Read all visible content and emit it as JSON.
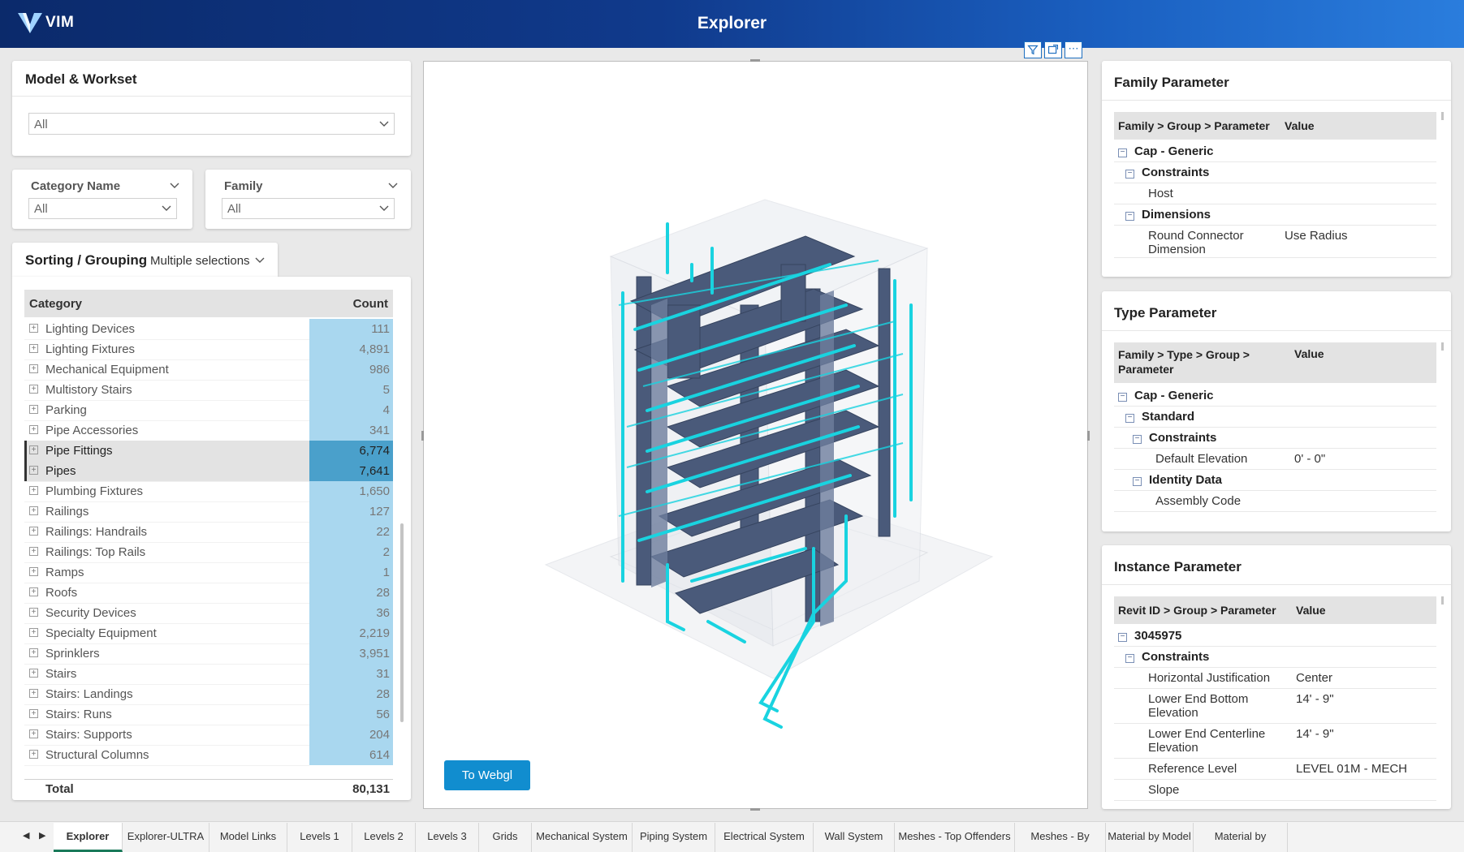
{
  "app": {
    "logo_text": "VIM",
    "title": "Explorer"
  },
  "model_workset": {
    "title": "Model & Workset",
    "value": "All"
  },
  "category_filter": {
    "title": "Category Name",
    "value": "All"
  },
  "family_filter": {
    "title": "Family",
    "value": "All"
  },
  "sorting": {
    "title": "Sorting / Grouping",
    "value": "Multiple selections"
  },
  "category_table": {
    "col_category": "Category",
    "col_count": "Count",
    "rows": [
      {
        "name": "Lighting Devices",
        "count": "111"
      },
      {
        "name": "Lighting Fixtures",
        "count": "4,891"
      },
      {
        "name": "Mechanical Equipment",
        "count": "986"
      },
      {
        "name": "Multistory Stairs",
        "count": "5"
      },
      {
        "name": "Parking",
        "count": "4"
      },
      {
        "name": "Pipe Accessories",
        "count": "341"
      },
      {
        "name": "Pipe Fittings",
        "count": "6,774"
      },
      {
        "name": "Pipes",
        "count": "7,641"
      },
      {
        "name": "Plumbing Fixtures",
        "count": "1,650"
      },
      {
        "name": "Railings",
        "count": "127"
      },
      {
        "name": "Railings: Handrails",
        "count": "22"
      },
      {
        "name": "Railings: Top Rails",
        "count": "2"
      },
      {
        "name": "Ramps",
        "count": "1"
      },
      {
        "name": "Roofs",
        "count": "28"
      },
      {
        "name": "Security Devices",
        "count": "36"
      },
      {
        "name": "Specialty Equipment",
        "count": "2,219"
      },
      {
        "name": "Sprinklers",
        "count": "3,951"
      },
      {
        "name": "Stairs",
        "count": "31"
      },
      {
        "name": "Stairs: Landings",
        "count": "28"
      },
      {
        "name": "Stairs: Runs",
        "count": "56"
      },
      {
        "name": "Stairs: Supports",
        "count": "204"
      },
      {
        "name": "Structural Columns",
        "count": "614"
      }
    ],
    "total_label": "Total",
    "total_value": "80,131"
  },
  "viewer": {
    "button_label": "To Webgl"
  },
  "family_param": {
    "title": "Family Parameter",
    "col_key": "Family > Group > Parameter",
    "col_value": "Value",
    "rows": [
      {
        "k": "Cap - Generic",
        "v": ""
      },
      {
        "k": "Constraints",
        "v": ""
      },
      {
        "k": "Host",
        "v": ""
      },
      {
        "k": "Dimensions",
        "v": ""
      },
      {
        "k": "Round Connector Dimension",
        "v": "Use Radius"
      }
    ]
  },
  "type_param": {
    "title": "Type Parameter",
    "col_key": "Family > Type > Group > Parameter",
    "col_value": "Value",
    "rows": [
      {
        "k": "Cap - Generic",
        "v": ""
      },
      {
        "k": "Standard",
        "v": ""
      },
      {
        "k": "Constraints",
        "v": ""
      },
      {
        "k": "Default Elevation",
        "v": "0' - 0\""
      },
      {
        "k": "Identity Data",
        "v": ""
      },
      {
        "k": "Assembly Code",
        "v": ""
      }
    ]
  },
  "instance_param": {
    "title": "Instance Parameter",
    "col_key": "Revit ID > Group > Parameter",
    "col_value": "Value",
    "rows": [
      {
        "k": "3045975",
        "v": ""
      },
      {
        "k": "Constraints",
        "v": ""
      },
      {
        "k": "Horizontal Justification",
        "v": "Center"
      },
      {
        "k": "Lower End Bottom Elevation",
        "v": "14' - 9\""
      },
      {
        "k": "Lower End Centerline Elevation",
        "v": "14' - 9\""
      },
      {
        "k": "Reference Level",
        "v": "LEVEL 01M - MECH"
      },
      {
        "k": "Slope",
        "v": ""
      }
    ]
  },
  "tabs": [
    "Explorer",
    "Explorer-ULTRA",
    "Model Links",
    "Levels 1",
    "Levels 2",
    "Levels 3",
    "Grids",
    "Mechanical System",
    "Piping System",
    "Electrical System",
    "Wall System",
    "Meshes - Top Offenders",
    "Meshes - By Model",
    "Material by Model",
    "Material by Category"
  ],
  "colors": {
    "accent": "#118dcf",
    "bar": "#a9d7ef",
    "bar_selected": "#4aa0cb",
    "header": "#103a8c",
    "pipe_cyan": "#19d3e0",
    "duct_slate": "#4a5a7a"
  }
}
